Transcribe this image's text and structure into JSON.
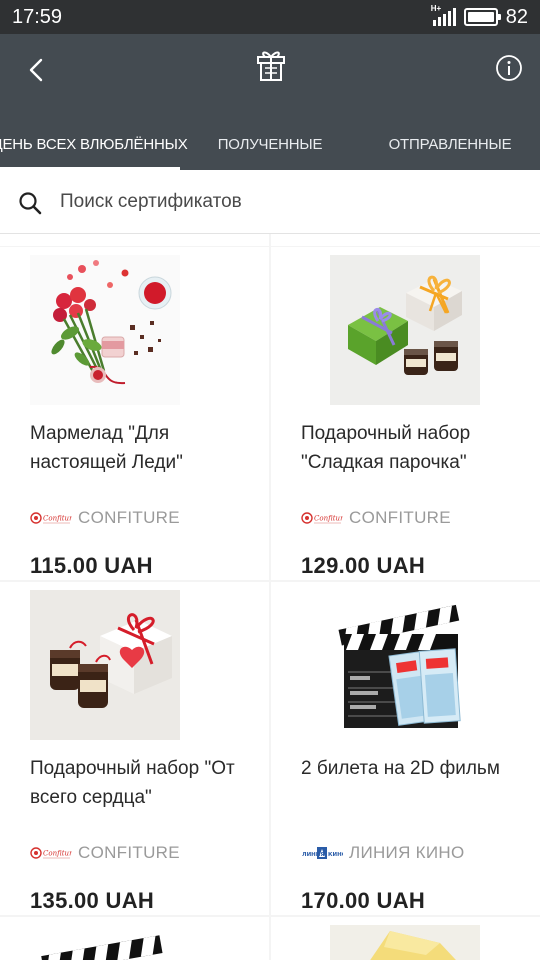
{
  "status_bar": {
    "time": "17:59",
    "network": "H+",
    "battery": "82"
  },
  "header": {
    "back_icon": "back-arrow-icon",
    "logo_icon": "gift-box-logo-icon",
    "info_icon": "info-icon"
  },
  "tabs": [
    {
      "label": "ДЕНЬ ВСЕХ ВЛЮБЛЁННЫХ",
      "active": true
    },
    {
      "label": "ПОЛУЧЕННЫЕ",
      "active": false
    },
    {
      "label": "ОТПРАВЛЕННЫЕ",
      "active": false
    }
  ],
  "search": {
    "placeholder": "Поиск сертификатов",
    "value": ""
  },
  "products": [
    {
      "title": "Мармелад \"Для настоящей Леди\"",
      "brand": "CONFITURE",
      "price": "115.00 UAH",
      "image": "roses-and-jam"
    },
    {
      "title": "Подарочный набор \"Сладкая парочка\"",
      "brand": "CONFITURE",
      "price": "129.00 UAH",
      "image": "gift-boxes-and-jars"
    },
    {
      "title": "Подарочный набор \"От всего сердца\"",
      "brand": "CONFITURE",
      "price": "135.00 UAH",
      "image": "jars-and-heart-box"
    },
    {
      "title": "2 билета на 2D фильм",
      "brand": "ЛИНИЯ КИНО",
      "price": "170.00 UAH",
      "image": "clapperboard-and-tickets"
    }
  ],
  "brand_logo_texts": {
    "confiture": "Confiture",
    "kino": "ЛИНИЯ КИНО"
  },
  "colors": {
    "header": "#444b51",
    "status_bar": "#2f3133",
    "confiture_red": "#d6322f"
  }
}
